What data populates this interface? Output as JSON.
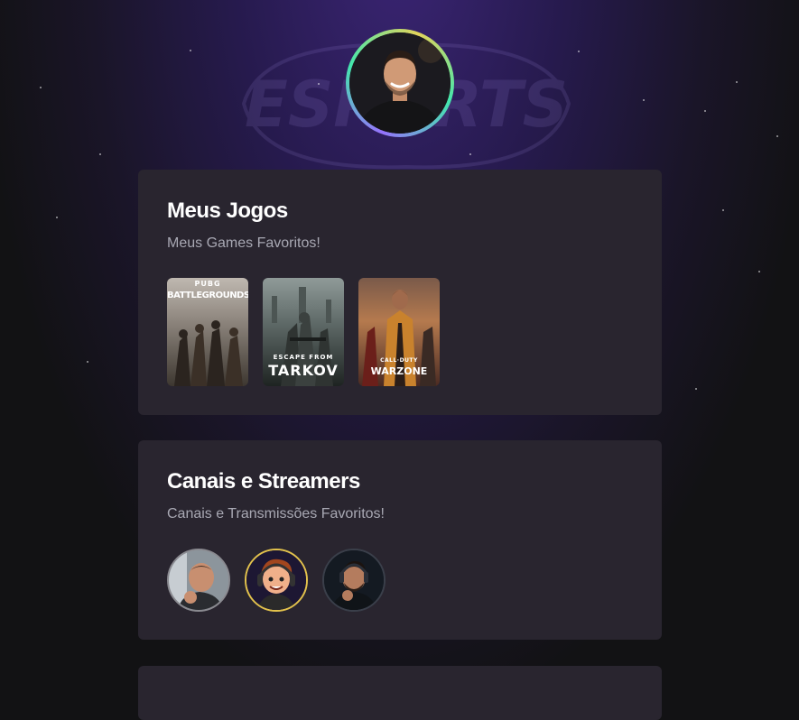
{
  "profile": {
    "avatar_icon": "profile-photo"
  },
  "background": {
    "watermark_icon": "esports-logo-watermark"
  },
  "cards": [
    {
      "title": "Meus Jogos",
      "subtitle": "Meus Games Favoritos!",
      "games": [
        {
          "name": "PUBG BATTLEGROUNDS",
          "top_text": "PUBG",
          "main_text": "BATTLEGROUNDS"
        },
        {
          "name": "ESCAPE FROM TARKOV",
          "top_text": "ESCAPE FROM",
          "main_text": "TARKOV"
        },
        {
          "name": "CALL OF DUTY WARZONE",
          "top_text": "CALL·DUTY",
          "main_text": "WARZONE"
        }
      ]
    },
    {
      "title": "Canais e Streamers",
      "subtitle": "Canais e Transmissões Favoritos!",
      "streamers": [
        {
          "icon": "streamer-avatar-1"
        },
        {
          "icon": "streamer-avatar-2"
        },
        {
          "icon": "streamer-avatar-3"
        }
      ]
    }
  ],
  "colors": {
    "gradient_start": "#9572fc",
    "gradient_mid": "#43e7ad",
    "gradient_end": "#e2d45c",
    "card_bg": "#29252f",
    "page_bg": "#121214"
  }
}
